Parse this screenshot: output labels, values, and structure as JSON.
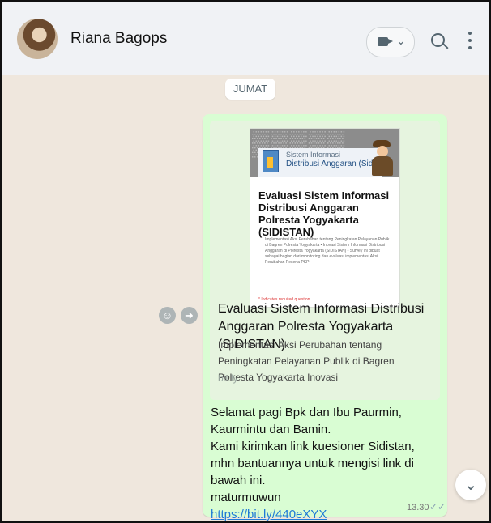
{
  "header": {
    "contact_name": "Riana Bagops",
    "icons": [
      "video-call-icon",
      "dropdown-icon",
      "search-icon",
      "menu-icon"
    ]
  },
  "chat": {
    "date_label": "JUMAT",
    "preview": {
      "banner_title": "Sistem Informasi",
      "banner_subtitle": "Distribusi Anggaran (Sidistan)",
      "document_title": "Evaluasi Sistem Informasi Distribusi Anggaran Polresta Yogyakarta (SIDISTAN)",
      "document_list": "Implementasi Aksi Perubahan tentang Peningkatan Pelayanan Publik di Bagren Polresta Yogyakarta • Inovasi Sistem Informasi Distribusi Anggaran di Polresta Yogyakarta (SIDISTAN) • Survey ini dibuat sebagai bagian dari monitoring dan evaluasi implementasi Aksi Perubahan Peserta PKP",
      "required_note": "* Indicates required question",
      "link_title": "Evaluasi Sistem Informasi Distribusi Anggaran Polresta Yogyakarta (SIDISTAN)",
      "link_description": "Implementasi Aksi Perubahan tentang Peningkatan Pelayanan Publik di Bagren Polresta Yogyakarta Inovasi",
      "domain": "bit.ly"
    },
    "message": {
      "line1": "Selamat pagi Bpk dan Ibu Paurmin, Kaurmintu dan Bamin.",
      "line2": "Kami kirimkan link kuesioner Sidistan, mhn bantuannya untuk mengisi link di bawah ini.",
      "line3": "maturmuwun",
      "link": "https://bit.ly/440eXYX",
      "time": "13.30",
      "ticks": "✓✓"
    },
    "actions": {
      "react": "☺",
      "forward": "➜"
    },
    "scroll_down": "⌄"
  },
  "colors": {
    "chat_background": "#efe7dd",
    "outgoing_bubble": "#d9fdd3",
    "header_background": "#f0f2f5",
    "link": "#1f7ad6"
  }
}
